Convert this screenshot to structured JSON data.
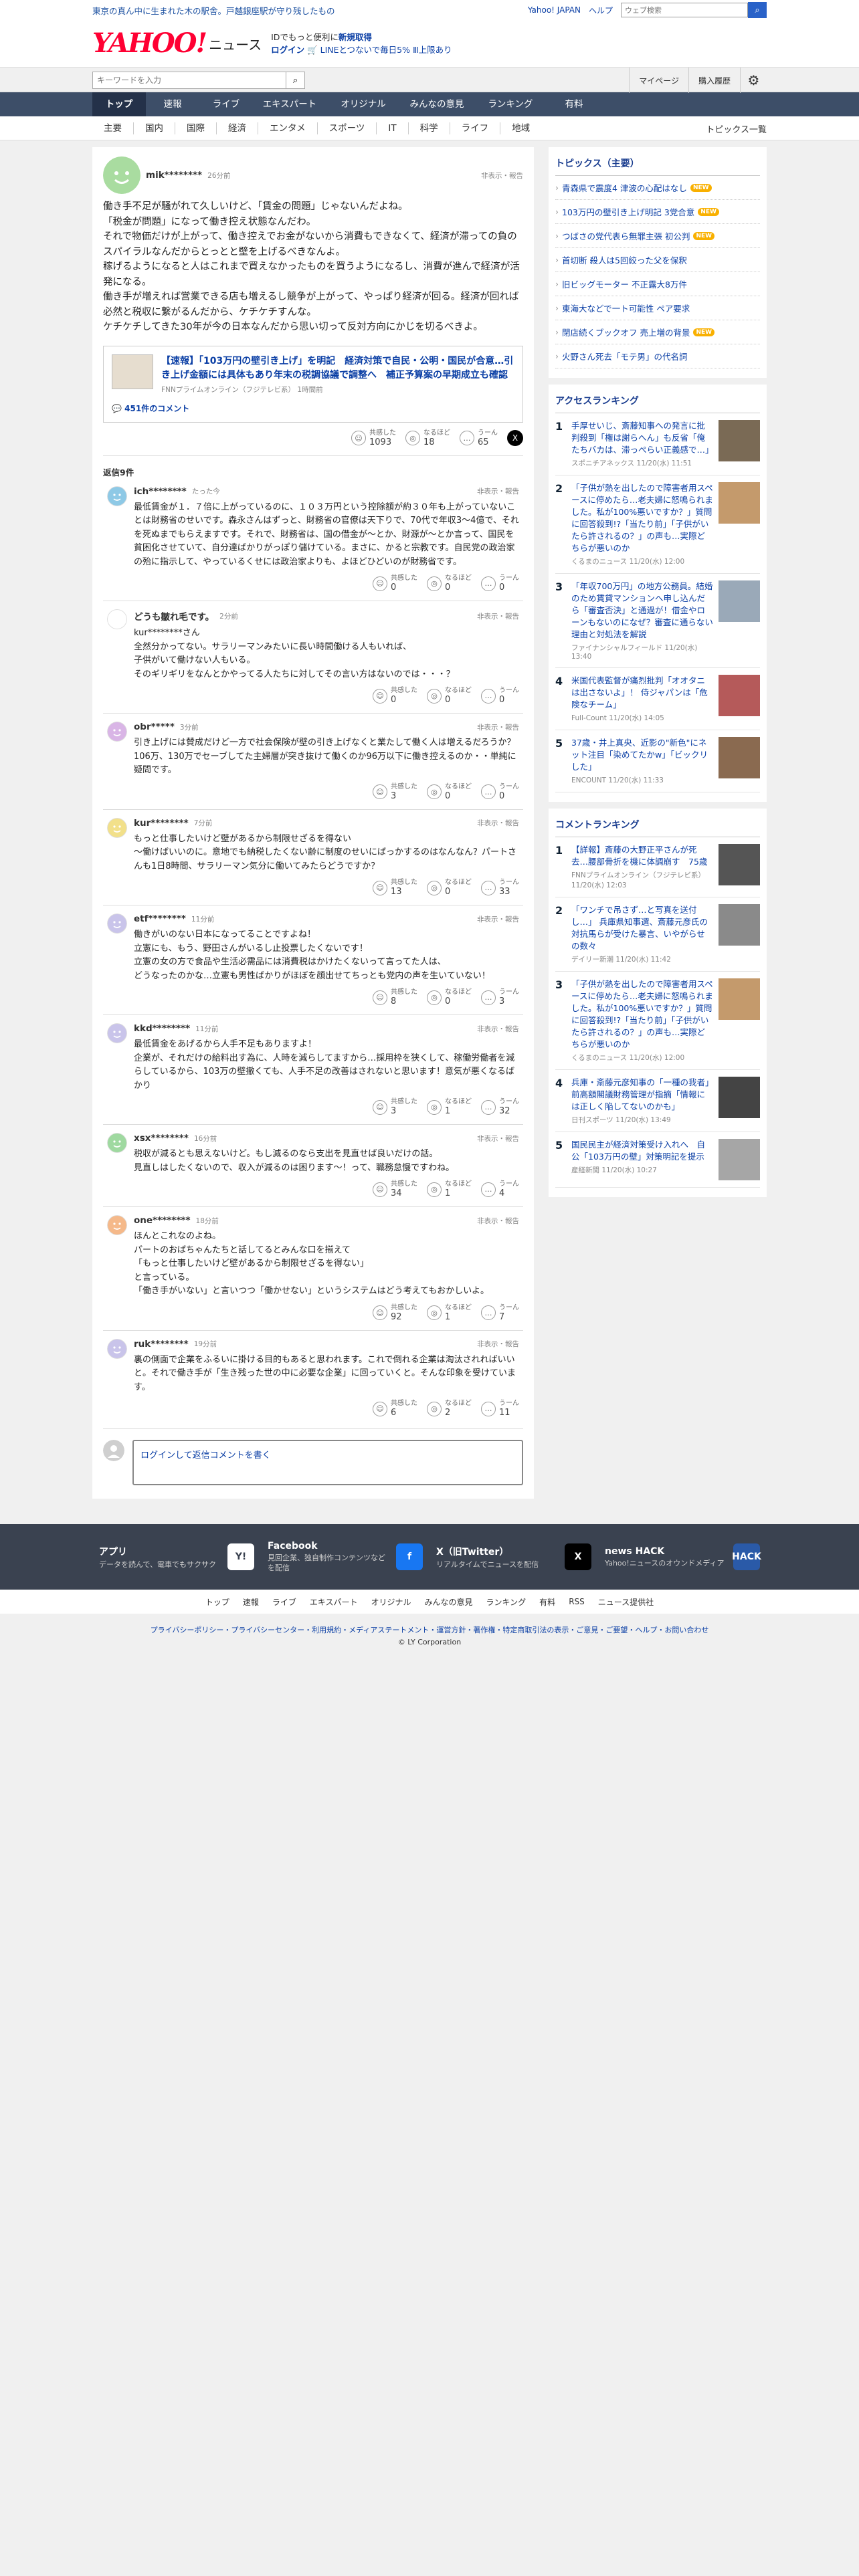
{
  "topbar": {
    "notice": "東京の真ん中に生まれた木の駅舎。戸越銀座駅が守り残したもの",
    "links": [
      "Yahoo! JAPAN",
      "ヘルプ"
    ],
    "search_placeholder": "ウェブ検索",
    "search_icon": "search-icon"
  },
  "header": {
    "logo": "YAHOO! JAPAN",
    "logo_sub": "ニュース",
    "promo_line1_pre": "IDでもっと便利に",
    "promo_line1_link": "新規取得",
    "promo_login": "ログイン",
    "promo_line2": "LINEとつないで毎日5% Ⅲ上限あり"
  },
  "searchrow": {
    "placeholder": "キーワードを入力",
    "mypage": "マイページ",
    "history": "購入履歴"
  },
  "gnav": [
    "トップ",
    "速報",
    "ライブ",
    "エキスパート",
    "オリジナル",
    "みんなの意見",
    "ランキング",
    "有料"
  ],
  "subnav": {
    "items": [
      "主要",
      "国内",
      "国際",
      "経済",
      "エンタメ",
      "スポーツ",
      "IT",
      "科学",
      "ライフ",
      "地域"
    ],
    "all": "トピックス一覧"
  },
  "comment": {
    "user": "mik********",
    "time": "26分前",
    "report": "非表示・報告",
    "body": "働き手不足が騒がれて久しいけど、「賃金の問題」じゃないんだよね。\n「税金が問題」になって働き控え状態なんだわ。\nそれで物価だけが上がって、働き控えでお金がないから消費もできなくて、経済が滞っての負のスパイラルなんだからとっとと壁を上げるべきなんよ。\n稼げるようになると人はこれまで買えなかったものを買うようになるし、消費が進んで経済が活発になる。\n働き手が増えれば営業できる店も増えるし競争が上がって、やっぱり経済が回る。経済が回れば必然と税収に繋がるんだから、ケチケチすんな。\nケチケチしてきた30年が今の日本なんだから思い切って反対方向にかじを切るべきよ。",
    "article": {
      "title": "【速報】「103万円の壁引き上げ」を明記　経済対策で自民・公明・国民が合意…引き上げ金額には具体もあり年末の税調協議で調整へ　補正予算案の早期成立も確認",
      "source": "FNNプライムオンライン（フジテレビ系）",
      "age": "1時間前",
      "comments": "451件のコメント"
    },
    "reactions": {
      "a_label": "共感した",
      "a": "1093",
      "b_label": "なるほど",
      "b": "18",
      "c_label": "うーん",
      "c": "65"
    }
  },
  "replies_heading": "返信9件",
  "replies": [
    {
      "user": "ich********",
      "time": "たった今",
      "report": "非表示・報告",
      "body": "最低賃金が１．７倍に上がっているのに、１０３万円という控除額が約３０年も上がっていないことは財務省のせいです。森永さんはずっと、財務省の官僚は天下りで、70代で年収3～4億で、それを死ぬまでもらえますです。それで、財務省は、国の借金が～とか、財源が～とか言って、国民を貧困化させていて、自分達ばかりがっぽり儲けている。まさに、かると宗教です。自民党の政治家の殆に指示して、やっているくせには政治家よりも、よほどひどいのが財務省です。",
      "r": [
        "0",
        "0",
        "0"
      ],
      "color": "#8ec9e6"
    },
    {
      "user": "どうも皺れ毛です。",
      "time": "2分前",
      "report": "非表示・報告",
      "body": "kur********さん\n全然分かってない。サラリーマンみたいに長い時間働ける人もいれば、\n子供がいて働けない人もいる。\nそのギリギリをなんとかやってる人たちに対してその言い方はないのでは・・・？",
      "r": [
        "0",
        "0",
        "0"
      ],
      "color": "#ffffff"
    },
    {
      "user": "obr*****",
      "time": "3分前",
      "report": "非表示・報告",
      "body": "引き上げには賛成だけど一方で社会保険が壁の引き上げなくと業たして働く人は増えるだろうか？106万、130万でセーブしてた主婦層が突き抜けて働くのか96万以下に働き控えるのか・・単純に疑問です。",
      "r": [
        "3",
        "0",
        "0"
      ],
      "color": "#d9b5e6"
    },
    {
      "user": "kur********",
      "time": "7分前",
      "report": "非表示・報告",
      "body": "もっと仕事したいけど壁があるから制限せざるを得ない\n～働けばいいのに。意地でも納税したくない齢に制度のせいにばっかするのはなんなん？パートさんも1日8時間、サラリーマン気分に働いてみたらどうですか？",
      "r": [
        "13",
        "0",
        "33"
      ],
      "color": "#f2e08a"
    },
    {
      "user": "etf********",
      "time": "11分前",
      "report": "非表示・報告",
      "body": "働きがいのない日本になってることですよね！\n立憲にも、もう、野田さんがいるし止投票したくないです！\n立憲の女の方で食品や生活必需品には消費税はかけたくないって言ってた人は、\nどうなったのかな…立憲も男性ばかりがほぼを顔出せてちっとも党内の声を生いていない！",
      "r": [
        "8",
        "0",
        "3"
      ],
      "color": "#c9c4ea"
    },
    {
      "user": "kkd********",
      "time": "11分前",
      "report": "非表示・報告",
      "body": "最低賃金をあげるから人手不足もありますよ！\n企業が、それだけの給料出す為に、人時を減らしてますから…採用枠を狭くして、稼働労働者を減らしているから、103万の壁撤くても、人手不足の改善はされないと思います！意気が悪くなるばかり",
      "r": [
        "3",
        "1",
        "32"
      ],
      "color": "#c9c4ea"
    },
    {
      "user": "xsx********",
      "time": "16分前",
      "report": "非表示・報告",
      "body": "税収が減るとも思えないけど。もし減るのなら支出を見直せば良いだけの話。\n見直しはしたくないので、収入が減るのは困ります～！って、職務怠慢ですわね。",
      "r": [
        "34",
        "1",
        "4"
      ],
      "color": "#9fd9a0"
    },
    {
      "user": "one********",
      "time": "18分前",
      "report": "非表示・報告",
      "body": "ほんとこれなのよね。\nパートのおばちゃんたちと話してるとみんな口を揃えて\n「もっと仕事したいけど壁があるから制限せざるを得ない」\nと言っている。\n「働き手がいない」と言いつつ「働かせない」というシステムはどう考えてもおかしいよ。",
      "r": [
        "92",
        "1",
        "7"
      ],
      "color": "#f5b98a"
    },
    {
      "user": "ruk********",
      "time": "19分前",
      "report": "非表示・報告",
      "body": "裏の側面で企業をふるいに掛ける目的もあると思われます。これで倒れる企業は淘汰されればいいと。それで働き手が「生き残った世の中に必要な企業」に回っていくと。そんな印象を受けています。",
      "r": [
        "6",
        "2",
        "11"
      ],
      "color": "#c9c4ea"
    }
  ],
  "reply_form": {
    "login": "ログイン",
    "rest": "して返信コメントを書く"
  },
  "sidebar": {
    "topics_title": "トピックス（主要）",
    "topics": [
      {
        "t": "青森県で震度4 津波の心配はなし",
        "new": "NEW"
      },
      {
        "t": "103万円の壁引き上げ明記 3党合意",
        "new": "NEW"
      },
      {
        "t": "つばさの党代表ら無罪主張 初公判",
        "new": "NEW"
      },
      {
        "t": "首切断 殺人は5回絞った父を保釈",
        "new": ""
      },
      {
        "t": "旧ビッグモーター 不正露大8万件",
        "new": ""
      },
      {
        "t": "東海大などで一ト可能性 ペア要求",
        "new": ""
      },
      {
        "t": "閉店続くブックオフ 売上増の背景",
        "new": "NEW"
      },
      {
        "t": "火野さん死去「モテ男」の代名詞",
        "new": ""
      }
    ],
    "access_title": "アクセスランキング",
    "access": [
      {
        "t": "手厚せいじ、斎藤知事への発言に批判殺到「権は謝らへん」も反省「俺たちバカは、滞っぺらい正義感で…」",
        "s": "スポニチアネックス 11/20(水) 11:51",
        "c": "#7a6a55"
      },
      {
        "t": "「子供が熱を出したので障害者用スペースに停めたら…老夫婦に怒鳴られました。私が100%悪いですか？」質問に回答殺到!?「当たり前」「子供がいたら許されるの？」の声も…実際どちらが悪いのか",
        "s": "くるまのニュース 11/20(水) 12:00",
        "c": "#c49a6c"
      },
      {
        "t": "「年収700万円」の地方公務員。結婚のため賃貸マンションへ申し込んだら「審査否決」と通過が！借金やローンもないのになぜ？審査に通らない理由と対処法を解説",
        "s": "ファイナンシャルフィールド 11/20(水) 13:40",
        "c": "#9aa9b8"
      },
      {
        "t": "米国代表監督が痛烈批判「オオタニは出さないよ」！ 侍ジャパンは「危険なチーム」",
        "s": "Full-Count 11/20(水) 14:05",
        "c": "#b55a5a"
      },
      {
        "t": "37歳・井上真央、近影の\"新色\"にネット注目「染めてたかw」「ビックリした」",
        "s": "ENCOUNT 11/20(水) 11:33",
        "c": "#8a6a50"
      }
    ],
    "comment_title": "コメントランキング",
    "comment_rank": [
      {
        "t": "【詳報】斎藤の大野正平さんが死去…腰部骨折を機に体調崩す　75歳",
        "s": "FNNプライムオンライン（フジテレビ系） 11/20(水) 12:03",
        "c": "#555555"
      },
      {
        "t": "「ワンチで吊さず…と写真を送付し…」 兵庫県知事選、斎藤元彦氏の対抗馬らが受けた暴言、いやがらせの数々",
        "s": "デイリー新潮 11/20(水) 11:42",
        "c": "#8a8a8a"
      },
      {
        "t": "「子供が熱を出したので障害者用スペースに停めたら…老夫婦に怒鳴られました。私が100%悪いですか？」質問に回答殺到!?「当たり前」「子供がいたら許されるの？」の声も…実際どちらが悪いのか",
        "s": "くるまのニュース 11/20(水) 12:00",
        "c": "#c49a6c"
      },
      {
        "t": "兵庫・斎藤元彦知事の「一種の我者」前高額閣議財務管理が指摘「情報には正しく陥してないのかも」",
        "s": "日刊スポーツ 11/20(水) 13:49",
        "c": "#444444"
      },
      {
        "t": "国民民主が経済対策受け入れへ　自公「103万円の壁」対策明記を提示",
        "s": "産経新聞 11/20(水) 10:27",
        "c": "#a6a6a6"
      }
    ]
  },
  "footer": {
    "banners": [
      {
        "h": "アプリ",
        "d": "データを読んで、電車でもサクサク",
        "icon": "yahoo-news-app-icon",
        "mark": "Y!",
        "bg": "#ffffff",
        "fg": "#3a4250"
      },
      {
        "h": "Facebook",
        "d": "見回企業、独自制作コンテンツなどを配信",
        "icon": "facebook-icon",
        "mark": "f",
        "bg": "#1877f2",
        "fg": "#ffffff"
      },
      {
        "h": "X（旧Twitter）",
        "d": "リアルタイムでニュースを配信",
        "icon": "x-icon",
        "mark": "X",
        "bg": "#000000",
        "fg": "#ffffff"
      },
      {
        "h": "news HACK",
        "d": "Yahoo!ニュースのオウンドメディア",
        "icon": "news-hack-icon",
        "mark": "HACK",
        "bg": "#2a5aa8",
        "fg": "#ffffff"
      }
    ],
    "nav": [
      "トップ",
      "速報",
      "ライブ",
      "エキスパート",
      "オリジナル",
      "みんなの意見",
      "ランキング",
      "有料",
      "RSS",
      "ニュース提供社"
    ],
    "links": "プライバシーポリシー・プライバシーセンター・利用規約・メディアステートメント・運営方針・著作権・特定商取引法の表示・ご意見・ご要望・ヘルプ・お問い合わせ",
    "copy": "© LY Corporation"
  },
  "colors": {
    "accent": "#0b3fa5",
    "nav_bg": "#3d4e68",
    "footer_bg": "#3a4250",
    "logo": "#ff0033"
  }
}
